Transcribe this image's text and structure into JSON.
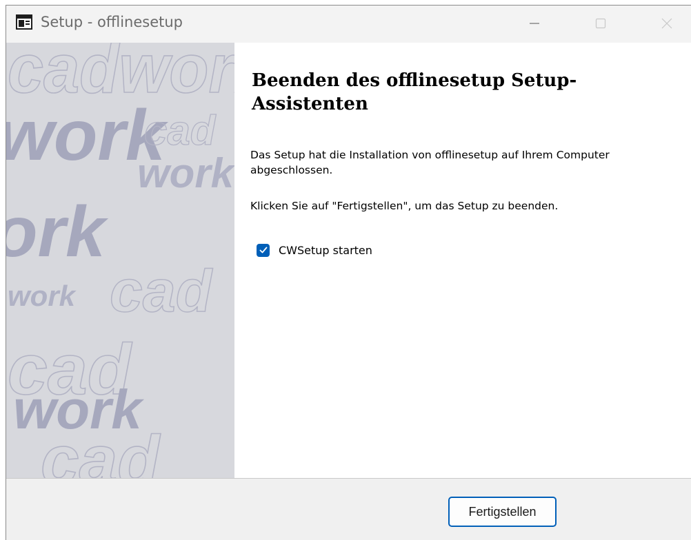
{
  "window": {
    "title": "Setup - offlinesetup",
    "controls": [
      "minimize-icon",
      "maximize-icon",
      "close-icon"
    ]
  },
  "sidebar": {
    "watermark_words": [
      "cadwork",
      "work",
      "cad",
      "work",
      "ork",
      "cad",
      "work",
      "cad",
      "work",
      "cad"
    ]
  },
  "content": {
    "heading": "Beenden des offlinesetup Setup-Assistenten",
    "paragraph1": "Das Setup hat die Installation von offlinesetup auf Ihrem Computer abgeschlossen.",
    "paragraph2": "Klicken Sie auf \"Fertigstellen\", um das Setup zu beenden.",
    "checkbox": {
      "label": "CWSetup starten",
      "checked": true
    }
  },
  "footer": {
    "finish_label": "Fertigstellen"
  },
  "colors": {
    "accent": "#005fb8",
    "sidebar_bg": "#d7d8dd",
    "watermark": "#aeb0c3"
  }
}
